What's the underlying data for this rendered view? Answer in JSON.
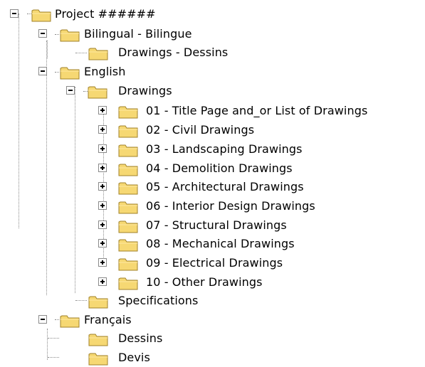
{
  "tree": {
    "root": {
      "label": "Project ######",
      "children": {
        "bilingual": {
          "label": "Bilingual - Bilingue",
          "children": {
            "drawings_dessins": {
              "label": "Drawings - Dessins"
            }
          }
        },
        "english": {
          "label": "English",
          "children": {
            "drawings": {
              "label": "Drawings",
              "items": [
                {
                  "label": "01 - Title Page and_or List of Drawings"
                },
                {
                  "label": "02 - Civil Drawings"
                },
                {
                  "label": "03 - Landscaping Drawings"
                },
                {
                  "label": "04 - Demolition Drawings"
                },
                {
                  "label": "05 - Architectural Drawings"
                },
                {
                  "label": "06 - Interior Design Drawings"
                },
                {
                  "label": "07 - Structural Drawings"
                },
                {
                  "label": "08 - Mechanical Drawings"
                },
                {
                  "label": "09 - Electrical Drawings"
                },
                {
                  "label": "10 - Other Drawings"
                }
              ]
            },
            "specifications": {
              "label": "Specifications"
            }
          }
        },
        "francais": {
          "label": "Français",
          "children": {
            "dessins": {
              "label": "Dessins"
            },
            "devis": {
              "label": "Devis"
            }
          }
        }
      }
    }
  },
  "colors": {
    "folder_fill": "#f6d873",
    "folder_stroke": "#a08228",
    "connector": "#8a8a8a",
    "text": "#000000",
    "background": "#ffffff"
  },
  "icons": {
    "expand": "plus-box",
    "collapse": "minus-box",
    "folder": "folder-icon"
  }
}
